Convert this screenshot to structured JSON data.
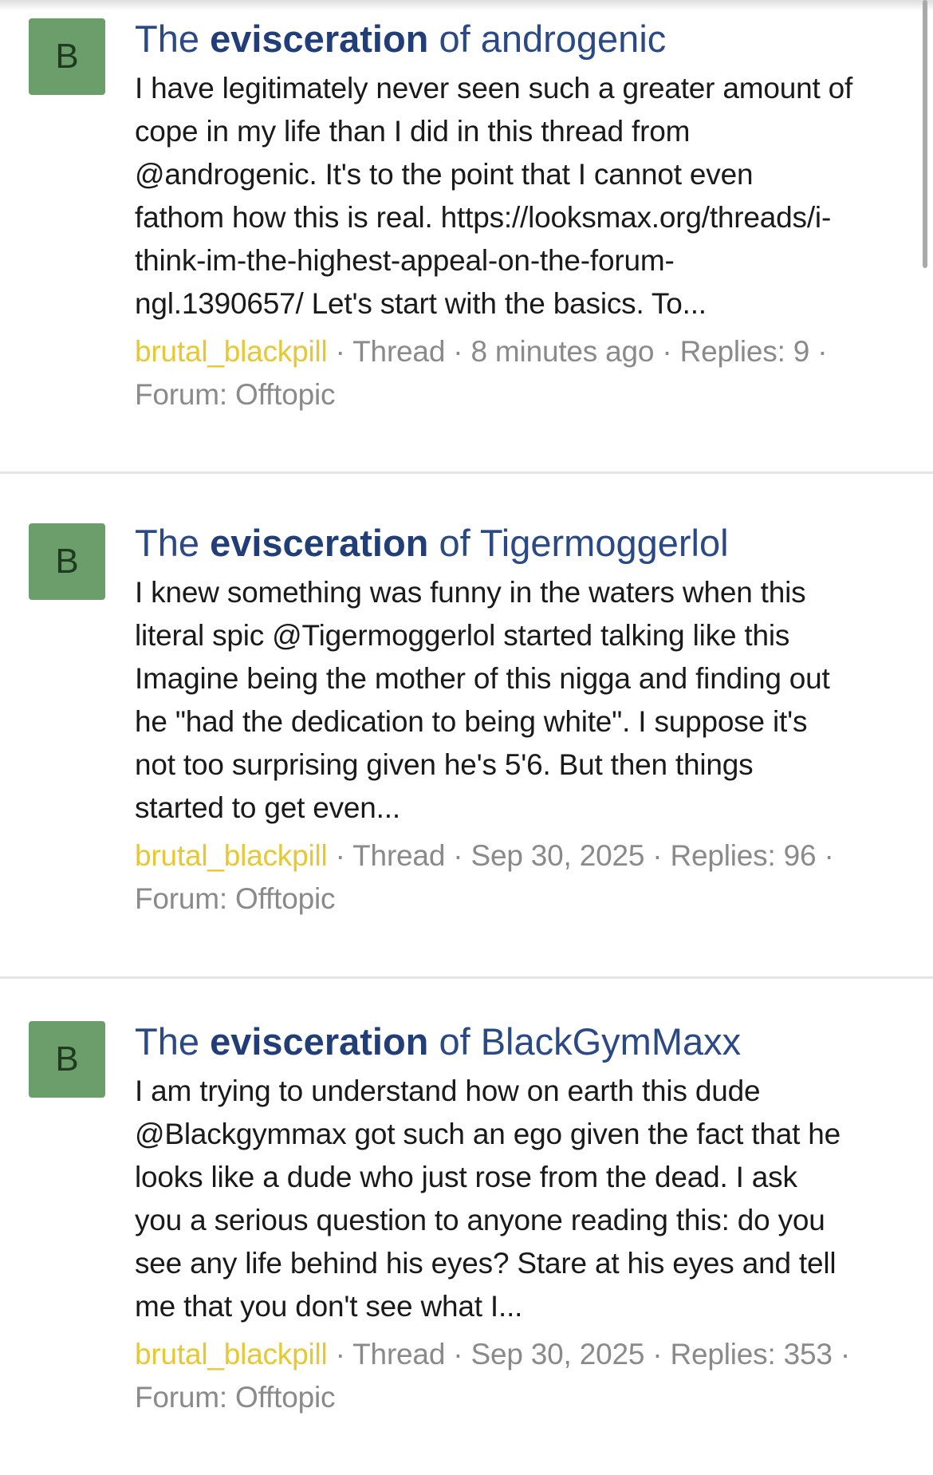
{
  "results": [
    {
      "avatar_letter": "B",
      "title_prefix": "The",
      "title_highlight": "evisceration",
      "title_suffix": "of androgenic",
      "snippet_lines": [
        "I have legitimately never seen such a greater amount of",
        "cope in my life than I did in this thread from",
        "@androgenic. It's to the point that I cannot even",
        "fathom how this is real. https://looksmax.org/threads/i-",
        "think-im-the-highest-appeal-on-the-forum-",
        "ngl.1390657/ Let's start with the basics. To..."
      ],
      "author": "brutal_blackpill",
      "meta_rest": " · Thread · 8 minutes ago · Replies: 9 ·",
      "forum": "Forum: Offtopic"
    },
    {
      "avatar_letter": "B",
      "title_prefix": "The",
      "title_highlight": "evisceration",
      "title_suffix": "of Tigermoggerlol",
      "snippet_lines": [
        "I knew something was funny in the waters when this",
        "literal spic @Tigermoggerlol started talking like this",
        "Imagine being the mother of this nigga and finding out",
        "he \"had the dedication to being white\". I suppose it's",
        "not too surprising given he's 5'6. But then things",
        "started to get even..."
      ],
      "author": "brutal_blackpill",
      "meta_rest": " · Thread · Sep 30, 2025 · Replies: 96 ·",
      "forum": "Forum: Offtopic"
    },
    {
      "avatar_letter": "B",
      "title_prefix": "The",
      "title_highlight": "evisceration",
      "title_suffix": "of BlackGymMaxx",
      "snippet_lines": [
        "I am trying to understand how on earth this dude",
        "@Blackgymmax got such an ego given the fact that he",
        "looks like a dude who just rose from the dead. I ask",
        "you a serious question to anyone reading this: do you",
        "see any life behind his eyes? Stare at his eyes and tell",
        "me that you don't see what I..."
      ],
      "author": "brutal_blackpill",
      "meta_rest": " · Thread · Sep 30, 2025 · Replies: 353 ·",
      "forum": "Forum: Offtopic"
    }
  ],
  "colors": {
    "title": "#2b4a85",
    "author": "#e7c733",
    "avatar_bg": "#6b9e6b",
    "meta": "#8a8a8a"
  }
}
